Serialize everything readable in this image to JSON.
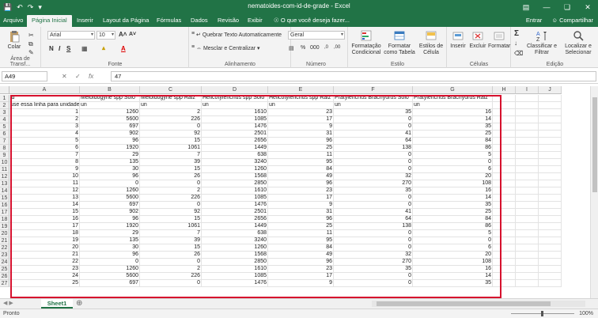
{
  "title_bar": {
    "document_title": "nematoides-com-id-de-grade - Excel",
    "qat": [
      "save-icon",
      "undo-icon",
      "redo-icon",
      "customize-icon"
    ]
  },
  "tabs": [
    "Arquivo",
    "Página Inicial",
    "Inserir",
    "Layout da Página",
    "Fórmulas",
    "Dados",
    "Revisão",
    "Exibir",
    "O que você deseja fazer..."
  ],
  "account": {
    "signin": "Entrar",
    "share": "Compartilhar"
  },
  "ribbon": {
    "paste": "Colar",
    "clipboard_label": "Área de Transf...",
    "font_name": "Arial",
    "font_size": "10",
    "font_label": "Fonte",
    "wrap_text": "Quebrar Texto Automaticamente",
    "merge_center": "Mesclar e Centralizar",
    "alignment_label": "Alinhamento",
    "number_format": "Geral",
    "number_label": "Número",
    "cond_format": "Formatação Condicional",
    "format_table": "Formatar como Tabela",
    "cell_styles": "Estilos de Célula",
    "styles_label": "Estilo",
    "insert": "Inserir",
    "delete": "Excluir",
    "format": "Formatar",
    "cells_label": "Células",
    "sort_filter": "Classificar e Filtrar",
    "find_select": "Localizar e Selecionar",
    "editing_label": "Edição"
  },
  "formula_bar": {
    "name_box": "A49",
    "formula": "47"
  },
  "columns": [
    "A",
    "B",
    "C",
    "D",
    "E",
    "F",
    "G",
    "H",
    "I",
    "J"
  ],
  "headers": [
    "id",
    "Meloidogyne spp Solo",
    "Meloidogyne spp Raiz",
    "Helicotylenchus spp Solo",
    "Helicotylenchus spp Raiz",
    "Pratylenchus Brachyurus Solo",
    "Pratylenchus Brachyurus Raiz"
  ],
  "units": [
    "use essa linha para unidades",
    "un",
    "un",
    "un",
    "un",
    "un",
    "un"
  ],
  "rows": [
    [
      "1",
      "1260",
      "2",
      "1610",
      "23",
      "35",
      "16"
    ],
    [
      "2",
      "5600",
      "226",
      "1085",
      "17",
      "0",
      "14"
    ],
    [
      "3",
      "697",
      "0",
      "1476",
      "9",
      "0",
      "35"
    ],
    [
      "4",
      "902",
      "92",
      "2501",
      "31",
      "41",
      "25"
    ],
    [
      "5",
      "96",
      "15",
      "2656",
      "96",
      "64",
      "84"
    ],
    [
      "6",
      "1920",
      "1061",
      "1449",
      "25",
      "138",
      "86"
    ],
    [
      "7",
      "29",
      "7",
      "638",
      "11",
      "0",
      "5"
    ],
    [
      "8",
      "135",
      "39",
      "3240",
      "95",
      "0",
      "0"
    ],
    [
      "9",
      "30",
      "15",
      "1260",
      "84",
      "0",
      "6"
    ],
    [
      "10",
      "96",
      "26",
      "1568",
      "49",
      "32",
      "20"
    ],
    [
      "11",
      "0",
      "0",
      "2850",
      "96",
      "270",
      "108"
    ],
    [
      "12",
      "1260",
      "2",
      "1610",
      "23",
      "35",
      "16"
    ],
    [
      "13",
      "5600",
      "226",
      "1085",
      "17",
      "0",
      "14"
    ],
    [
      "14",
      "697",
      "0",
      "1476",
      "9",
      "0",
      "35"
    ],
    [
      "15",
      "902",
      "92",
      "2501",
      "31",
      "41",
      "25"
    ],
    [
      "16",
      "96",
      "15",
      "2656",
      "96",
      "64",
      "84"
    ],
    [
      "17",
      "1920",
      "1061",
      "1449",
      "25",
      "138",
      "86"
    ],
    [
      "18",
      "29",
      "7",
      "638",
      "11",
      "0",
      "5"
    ],
    [
      "19",
      "135",
      "39",
      "3240",
      "95",
      "0",
      "0"
    ],
    [
      "20",
      "30",
      "15",
      "1260",
      "84",
      "0",
      "6"
    ],
    [
      "21",
      "96",
      "26",
      "1568",
      "49",
      "32",
      "20"
    ],
    [
      "22",
      "0",
      "0",
      "2850",
      "96",
      "270",
      "108"
    ],
    [
      "23",
      "1260",
      "2",
      "1610",
      "23",
      "35",
      "16"
    ],
    [
      "24",
      "5600",
      "226",
      "1085",
      "17",
      "0",
      "14"
    ],
    [
      "25",
      "697",
      "0",
      "1476",
      "9",
      "0",
      "35"
    ]
  ],
  "sheet_tab": "Sheet1",
  "status": {
    "ready": "Pronto",
    "zoom": "100%"
  },
  "colors": {
    "accent": "#217346",
    "selection": "#d6112e"
  }
}
